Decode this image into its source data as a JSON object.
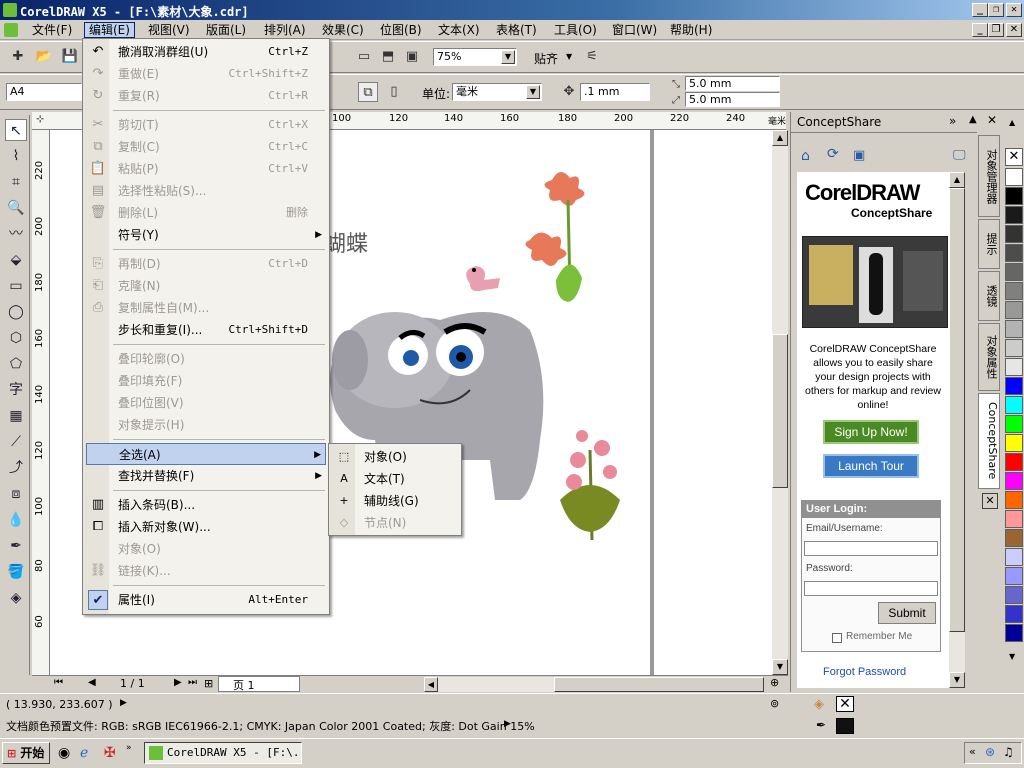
{
  "window": {
    "title": "CorelDRAW X5 - [F:\\素材\\大象.cdr]"
  },
  "menubar": [
    {
      "label": "文件(F)"
    },
    {
      "label": "编辑(E)"
    },
    {
      "label": "视图(V)"
    },
    {
      "label": "版面(L)"
    },
    {
      "label": "排列(A)"
    },
    {
      "label": "效果(C)"
    },
    {
      "label": "位图(B)"
    },
    {
      "label": "文本(X)"
    },
    {
      "label": "表格(T)"
    },
    {
      "label": "工具(O)"
    },
    {
      "label": "窗口(W)"
    },
    {
      "label": "帮助(H)"
    }
  ],
  "toolbar": {
    "zoom": "75%",
    "snap_label": "贴齐"
  },
  "propbar": {
    "page_size": "A4",
    "unit_label": "单位:",
    "unit_value": "毫米",
    "nudge": ".1 mm",
    "dup_x": "5.0 mm",
    "dup_y": "5.0 mm"
  },
  "ruler": {
    "h_labels": [
      "100",
      "120",
      "140",
      "160",
      "180",
      "200",
      "220",
      "240"
    ],
    "v_labels": [
      "220",
      "200",
      "180",
      "160",
      "140",
      "120",
      "100",
      "80",
      "60"
    ]
  },
  "canvas": {
    "text": "蝴蝶"
  },
  "edit_menu": {
    "items": [
      {
        "icon": "undo-icon",
        "glyph": "↶",
        "label": "撤消取消群组(U)",
        "shortcut": "Ctrl+Z",
        "enabled": true
      },
      {
        "icon": "redo-icon",
        "glyph": "↷",
        "label": "重做(E)",
        "shortcut": "Ctrl+Shift+Z",
        "enabled": false
      },
      {
        "icon": "repeat-icon",
        "glyph": "↻",
        "label": "重复(R)",
        "shortcut": "Ctrl+R",
        "enabled": false
      },
      {
        "sep": true
      },
      {
        "icon": "cut-icon",
        "glyph": "✂",
        "label": "剪切(T)",
        "shortcut": "Ctrl+X",
        "enabled": false
      },
      {
        "icon": "copy-icon",
        "glyph": "⧉",
        "label": "复制(C)",
        "shortcut": "Ctrl+C",
        "enabled": false
      },
      {
        "icon": "paste-icon",
        "glyph": "📋",
        "label": "粘贴(P)",
        "shortcut": "Ctrl+V",
        "enabled": false
      },
      {
        "icon": "paste-special-icon",
        "glyph": "▤",
        "label": "选择性粘贴(S)...",
        "shortcut": "",
        "enabled": false
      },
      {
        "icon": "delete-icon",
        "glyph": "🗑",
        "label": "删除(L)",
        "shortcut": "删除",
        "enabled": false
      },
      {
        "icon": "",
        "glyph": "",
        "label": "符号(Y)",
        "shortcut": "",
        "enabled": true,
        "submenu": true
      },
      {
        "sep": true
      },
      {
        "icon": "duplicate-icon",
        "glyph": "⎘",
        "label": "再制(D)",
        "shortcut": "Ctrl+D",
        "enabled": false
      },
      {
        "icon": "clone-icon",
        "glyph": "⎗",
        "label": "克隆(N)",
        "shortcut": "",
        "enabled": false
      },
      {
        "icon": "copy-properties-icon",
        "glyph": "⎙",
        "label": "复制属性自(M)...",
        "shortcut": "",
        "enabled": false
      },
      {
        "icon": "",
        "glyph": "",
        "label": "步长和重复(I)...",
        "shortcut": "Ctrl+Shift+D",
        "enabled": true
      },
      {
        "sep": true
      },
      {
        "icon": "",
        "glyph": "",
        "label": "叠印轮廓(O)",
        "shortcut": "",
        "enabled": false
      },
      {
        "icon": "",
        "glyph": "",
        "label": "叠印填充(F)",
        "shortcut": "",
        "enabled": false
      },
      {
        "icon": "",
        "glyph": "",
        "label": "叠印位图(V)",
        "shortcut": "",
        "enabled": false
      },
      {
        "icon": "",
        "glyph": "",
        "label": "对象提示(H)",
        "shortcut": "",
        "enabled": false
      },
      {
        "sep": true
      },
      {
        "icon": "",
        "glyph": "",
        "label": "全选(A)",
        "shortcut": "",
        "enabled": true,
        "submenu": true,
        "highlighted": true
      },
      {
        "icon": "",
        "glyph": "",
        "label": "查找并替换(F)",
        "shortcut": "",
        "enabled": true,
        "submenu": true
      },
      {
        "sep": true
      },
      {
        "icon": "barcode-icon",
        "glyph": "▥",
        "label": "插入条码(B)...",
        "shortcut": "",
        "enabled": true
      },
      {
        "icon": "insert-object-icon",
        "glyph": "⧠",
        "label": "插入新对象(W)...",
        "shortcut": "",
        "enabled": true
      },
      {
        "icon": "",
        "glyph": "",
        "label": "对象(O)",
        "shortcut": "",
        "enabled": false
      },
      {
        "icon": "link-icon",
        "glyph": "⛓",
        "label": "链接(K)...",
        "shortcut": "",
        "enabled": false
      },
      {
        "sep": true
      },
      {
        "icon": "checkmark-icon",
        "glyph": "✔",
        "label": "属性(I)",
        "shortcut": "Alt+Enter",
        "enabled": true
      }
    ]
  },
  "select_all_submenu": [
    {
      "icon": "select-objects-icon",
      "glyph": "⬚",
      "label": "对象(O)",
      "enabled": true
    },
    {
      "icon": "select-text-icon",
      "glyph": "A",
      "label": "文本(T)",
      "enabled": true
    },
    {
      "icon": "select-guidelines-icon",
      "glyph": "+",
      "label": "辅助线(G)",
      "enabled": true
    },
    {
      "icon": "select-nodes-icon",
      "glyph": "◇",
      "label": "节点(N)",
      "enabled": false
    }
  ],
  "docker": {
    "title": "ConceptShare",
    "logo_main": "CorelDRAW",
    "logo_sub": "ConceptShare",
    "description": "CorelDRAW ConceptShare allows you to easily share your design projects with others for markup and review online!",
    "signup": "Sign Up Now!",
    "tour": "Launch Tour",
    "login_title": "User Login:",
    "email_label": "Email/Username:",
    "password_label": "Password:",
    "submit": "Submit",
    "remember": "Remember Me",
    "forgot": "Forgot Password"
  },
  "vertical_tabs": [
    "对象管理器",
    "提示",
    "透镜",
    "对象属性",
    "ConceptShare"
  ],
  "palette": [
    "#ffffff",
    "#000000",
    "#1a1a1a",
    "#333333",
    "#4d4d4d",
    "#666666",
    "#808080",
    "#999999",
    "#b3b3b3",
    "#cccccc",
    "#e6e6e6",
    "#0000ff",
    "#00ffff",
    "#00ff00",
    "#ffff00",
    "#ff0000",
    "#ff00ff",
    "#ff6600",
    "#ff9999",
    "#996633",
    "#ccccff",
    "#9999ff",
    "#6666cc",
    "#3333cc",
    "#000099"
  ],
  "page_nav": {
    "count": "1 / 1",
    "tab": "页 1"
  },
  "status": {
    "coords": "( 13.930, 233.607 )",
    "profile": "文档颜色预置文件: RGB: sRGB IEC61966-2.1; CMYK: Japan Color 2001 Coated; 灰度: Dot Gain 15%"
  },
  "taskbar": {
    "start": "开始",
    "task": "CorelDRAW X5 - [F:\\..."
  }
}
